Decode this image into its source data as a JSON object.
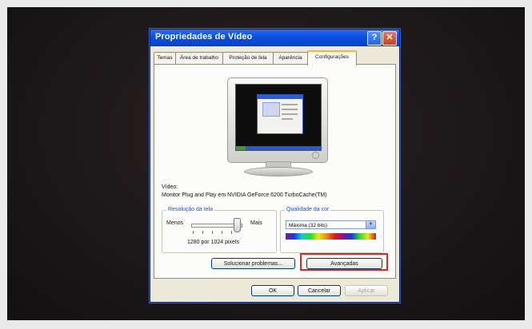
{
  "window": {
    "title": "Propriedades de Vídeo",
    "help_glyph": "?",
    "close_glyph": "✕"
  },
  "tabs": [
    {
      "label": "Temas",
      "active": false
    },
    {
      "label": "Área de trabalho",
      "active": false
    },
    {
      "label": "Proteção de tela",
      "active": false
    },
    {
      "label": "Aparência",
      "active": false
    },
    {
      "label": "Configurações",
      "active": true
    }
  ],
  "display": {
    "video_label": "Vídeo:",
    "video_value": "Monitor Plug and Play em NVIDIA GeForce 6200 TurboCache(TM)"
  },
  "resolution": {
    "group_label": "Resolução da tela",
    "less_label": "Menos",
    "more_label": "Mais",
    "value_text": "1280 por 1024 pixels",
    "slider_level": 0.95
  },
  "color_quality": {
    "group_label": "Qualidade da cor",
    "selected": "Máxima (32 bits)"
  },
  "buttons": {
    "troubleshoot": "Solucionar problemas...",
    "advanced": "Avançadas",
    "ok": "OK",
    "cancel": "Cancelar",
    "apply": "Aplicar"
  },
  "colors": {
    "titlebar": "#0a4fe0",
    "highlight": "#d42a2a",
    "background": "#ece9d8"
  }
}
